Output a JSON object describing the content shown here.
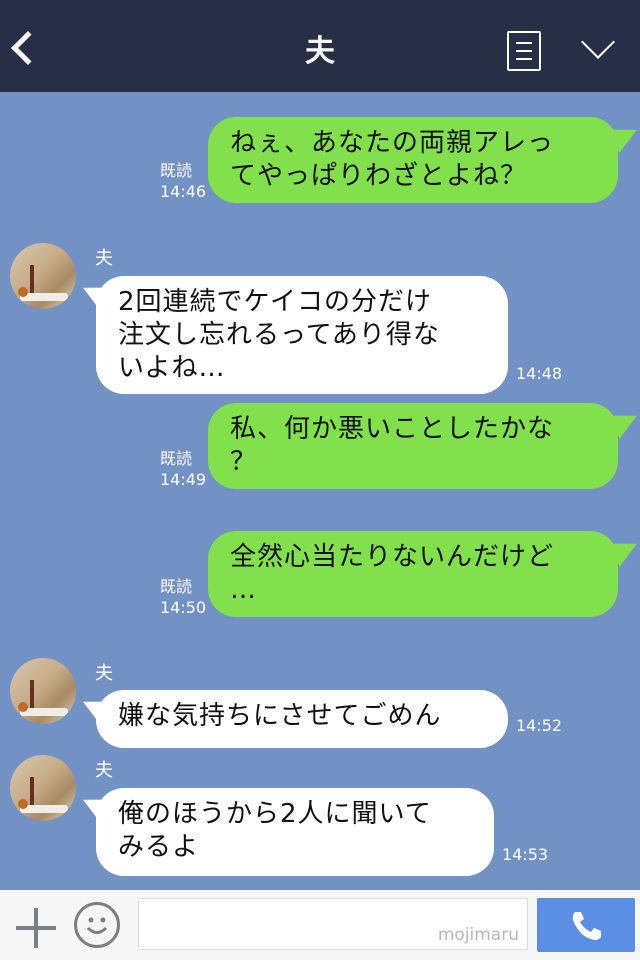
{
  "header": {
    "title": "夫"
  },
  "messages": [
    {
      "side": "out",
      "text": "ねぇ、あなたの両親アレっ\nてやっぱりわざとよね？",
      "read": "既読",
      "time": "14:46"
    },
    {
      "side": "in",
      "sender": "夫",
      "text": "2回連続でケイコの分だけ\n注文し忘れるってあり得な\nいよね…",
      "time": "14:48"
    },
    {
      "side": "out",
      "text": "私、何か悪いことしたかな\n？",
      "read": "既読",
      "time": "14:49"
    },
    {
      "side": "out",
      "text": "全然心当たりないんだけど\n…",
      "read": "既読",
      "time": "14:50"
    },
    {
      "side": "in",
      "sender": "夫",
      "text": "嫌な気持ちにさせてごめん",
      "time": "14:52"
    },
    {
      "side": "in",
      "sender": "夫",
      "text": "俺のほうから2人に聞いて\nみるよ",
      "time": "14:53"
    }
  ],
  "footer": {
    "watermark": "mojimaru"
  },
  "colors": {
    "background": "#7291c4",
    "header": "#262f45",
    "outgoing_bubble": "#82e04c",
    "incoming_bubble": "#ffffff",
    "call_button": "#5a8fe4"
  },
  "icons": [
    "back-icon",
    "menu-icon",
    "chevron-down-icon",
    "plus-icon",
    "emoji-icon",
    "phone-icon"
  ]
}
